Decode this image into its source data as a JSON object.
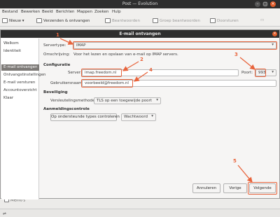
{
  "window": {
    "title": "Post — Evolution"
  },
  "menu": [
    "Bestand",
    "Bewerken",
    "Beeld",
    "Berichten",
    "Mappen",
    "Zoeken",
    "Hulp"
  ],
  "toolbar": {
    "new": "Nieuw",
    "send_receive": "Verzenden & ontvangen",
    "reply": "Beantwoorden",
    "reply_group": "Groep beantwoorden",
    "forward": "Doorsturen"
  },
  "background": {
    "memos": "Memo's"
  },
  "dialog": {
    "title": "E-mail ontvangen",
    "nav": [
      "Welkom",
      "Identiteit",
      "E-mail ontvangen",
      "Ontvangstinstellingen",
      "E-mail versturen",
      "Accountoverzicht",
      "Klaar"
    ],
    "server_type_label": "Servertype:",
    "server_type_value": "IMAP",
    "description_label": "Omschrijving:",
    "description_value": "Voor het lezen en opslaan van e-mail op IMAP servers.",
    "config_heading": "Configuratie",
    "server_label": "Server:",
    "server_value": "imap.freedom.nl",
    "port_label": "Poort:",
    "port_value": "993",
    "username_label": "Gebruikersnaam:",
    "username_value": "voorbeeld@freedom.nl",
    "security_heading": "Beveiliging",
    "encryption_label": "Versleutelingsmethode:",
    "encryption_value": "TLS op een toegewijde poort",
    "auth_heading": "Aanmeldingscontrole",
    "check_types_button": "Op ondersteunde types controleren",
    "auth_value": "Wachtwoord",
    "cancel_button": "Annuleren",
    "back_button": "Vorige",
    "next_button": "Volgende"
  },
  "annotations": {
    "color": "#e8643c",
    "labels": [
      "1",
      "2",
      "3",
      "4",
      "5"
    ]
  }
}
